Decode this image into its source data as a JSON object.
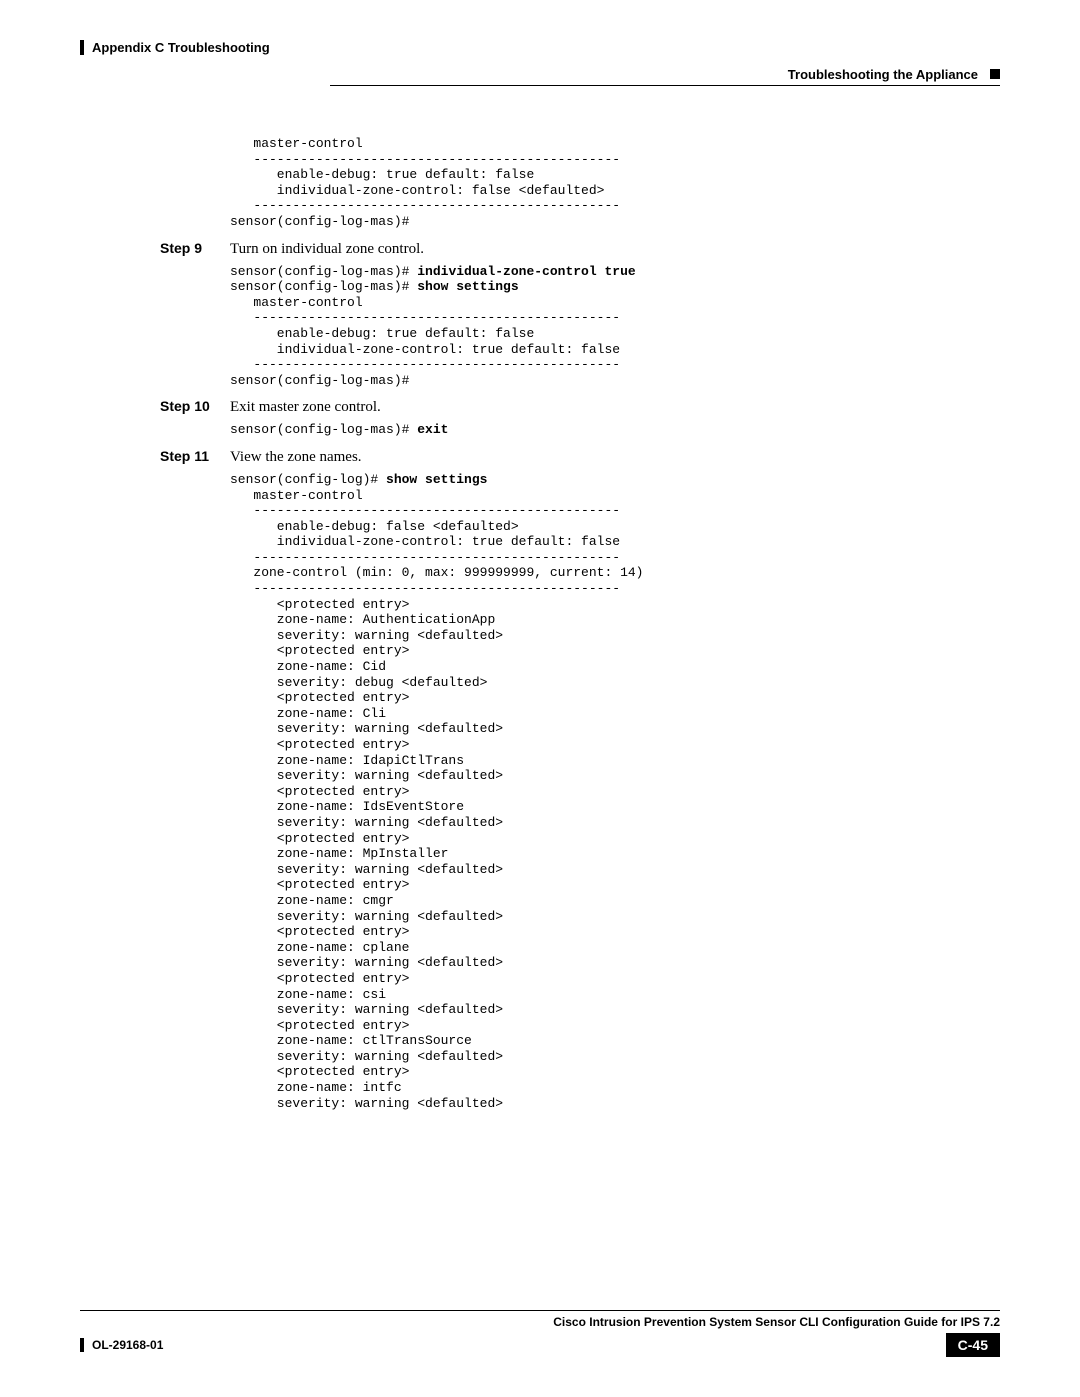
{
  "header": {
    "left": "Appendix C    Troubleshooting",
    "right": "Troubleshooting the Appliance"
  },
  "code1": "   master-control\n   -----------------------------------------------\n      enable-debug: true default: false\n      individual-zone-control: false <defaulted>\n   -----------------------------------------------\nsensor(config-log-mas)#",
  "step9": {
    "label": "Step 9",
    "text": "Turn on individual zone control."
  },
  "code2a": "sensor(config-log-mas)# ",
  "code2a_bold": "individual-zone-control true",
  "code2b": "sensor(config-log-mas)# ",
  "code2b_bold": "show settings",
  "code2c": "   master-control\n   -----------------------------------------------\n      enable-debug: true default: false\n      individual-zone-control: true default: false\n   -----------------------------------------------\nsensor(config-log-mas)#",
  "step10": {
    "label": "Step 10",
    "text": "Exit master zone control."
  },
  "code3a": "sensor(config-log-mas)# ",
  "code3a_bold": "exit",
  "step11": {
    "label": "Step 11",
    "text": "View the zone names."
  },
  "code4a": "sensor(config-log)# ",
  "code4a_bold": "show settings",
  "code4b": "   master-control\n   -----------------------------------------------\n      enable-debug: false <defaulted>\n      individual-zone-control: true default: false\n   -----------------------------------------------\n   zone-control (min: 0, max: 999999999, current: 14)\n   -----------------------------------------------\n      <protected entry>\n      zone-name: AuthenticationApp\n      severity: warning <defaulted>\n      <protected entry>\n      zone-name: Cid\n      severity: debug <defaulted>\n      <protected entry>\n      zone-name: Cli\n      severity: warning <defaulted>\n      <protected entry>\n      zone-name: IdapiCtlTrans\n      severity: warning <defaulted>\n      <protected entry>\n      zone-name: IdsEventStore\n      severity: warning <defaulted>\n      <protected entry>\n      zone-name: MpInstaller\n      severity: warning <defaulted>\n      <protected entry>\n      zone-name: cmgr\n      severity: warning <defaulted>\n      <protected entry>\n      zone-name: cplane\n      severity: warning <defaulted>\n      <protected entry>\n      zone-name: csi\n      severity: warning <defaulted>\n      <protected entry>\n      zone-name: ctlTransSource\n      severity: warning <defaulted>\n      <protected entry>\n      zone-name: intfc\n      severity: warning <defaulted>",
  "footer": {
    "title": "Cisco Intrusion Prevention System Sensor CLI Configuration Guide for IPS 7.2",
    "doc": "OL-29168-01",
    "page": "C-45"
  }
}
